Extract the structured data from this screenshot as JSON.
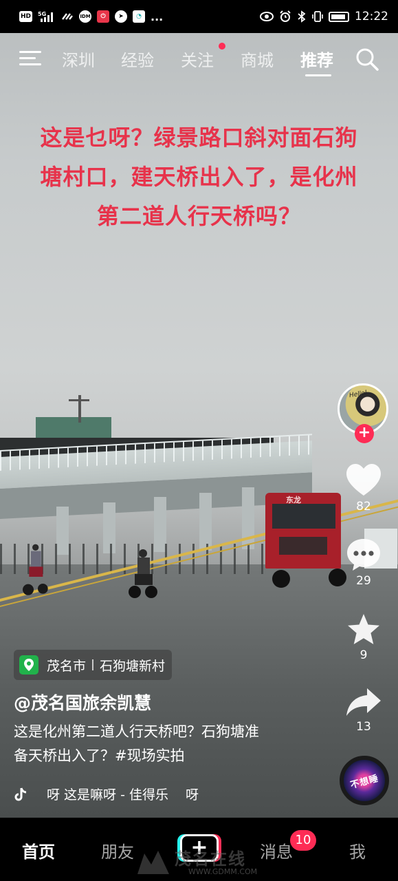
{
  "status_bar": {
    "left_icons": [
      "HD",
      "5G",
      "signal-icon",
      "link-icon",
      "IDM",
      "app-icon-red",
      "app-icon-white",
      "chat-bubble-icon",
      "..."
    ],
    "time": "12:22"
  },
  "top_nav": {
    "tabs": [
      {
        "label": "深圳"
      },
      {
        "label": "经验"
      },
      {
        "label": "关注"
      },
      {
        "label": "商城"
      },
      {
        "label": "推荐"
      }
    ],
    "active_tab": "推荐"
  },
  "video": {
    "caption_lines": [
      "这是乜呀？绿景路口斜对面石狗",
      "塘村口，建天桥出入了，是化州",
      "第二道人行天桥吗？"
    ],
    "truck_label": "东龙"
  },
  "actions": {
    "avatar_text": "Hello!",
    "follow_plus": "+",
    "likes": "82",
    "comments": "29",
    "favorites": "9",
    "shares": "13"
  },
  "info": {
    "location_city": "茂名市",
    "location_place": "石狗塘新村",
    "username": "@茂名国旅余凯慧",
    "description_line1": "这是化州第二道人行天桥吧？石狗塘准",
    "description_line2": "备天桥出入了？#现场实拍",
    "music": "呀 这是嘛呀 - 佳得乐 　呀",
    "disc_text": "不想睡"
  },
  "bottom_nav": {
    "home": "首页",
    "friends": "朋友",
    "add": "+",
    "messages": "消息",
    "messages_badge": "10",
    "me": "我"
  },
  "watermark": {
    "text": "茂名在线",
    "url": "WWW.GDMM.COM"
  },
  "colors": {
    "accent": "#fe2c55",
    "caption": "#e7334b",
    "location_pin": "#21b24b"
  }
}
